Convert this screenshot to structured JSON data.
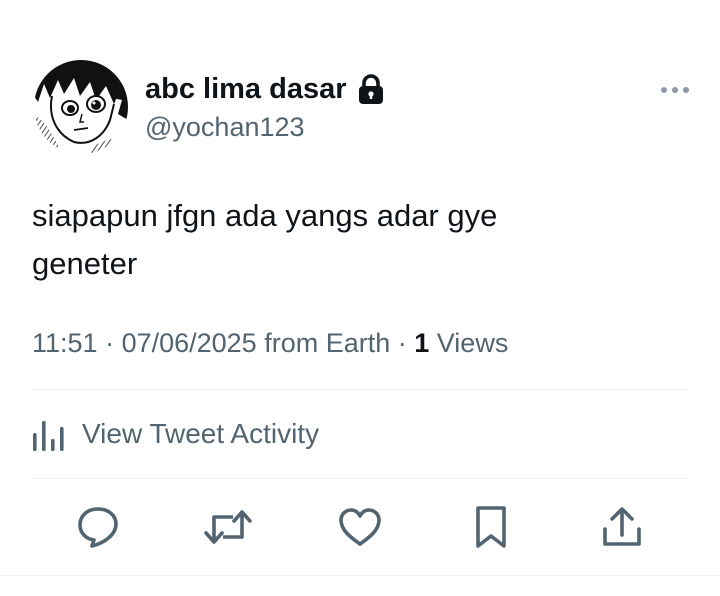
{
  "author": {
    "display_name": "abc lima dasar",
    "handle": "@yochan123",
    "protected": true,
    "avatar": "manga-style-character-avatar"
  },
  "tweet": {
    "text_line1": "siapapun jfgn ada yangs adar gye",
    "text_line2": "geneter"
  },
  "meta": {
    "time": "11:51",
    "sep1": " · ",
    "date": "07/06/2025",
    "from": " from Earth",
    "sep2": " · ",
    "views_count": "1",
    "views_label": " Views"
  },
  "activity": {
    "label": "View Tweet Activity",
    "icon": "analytics-bars-icon"
  },
  "actions": [
    {
      "name": "reply",
      "icon": "reply-icon"
    },
    {
      "name": "retweet",
      "icon": "retweet-icon"
    },
    {
      "name": "like",
      "icon": "heart-icon"
    },
    {
      "name": "bookmark",
      "icon": "bookmark-icon"
    },
    {
      "name": "share",
      "icon": "share-icon"
    }
  ],
  "colors": {
    "text_primary": "#0f1419",
    "text_secondary": "#536471",
    "divider": "#eff3f4",
    "more_dots": "#8b98a5"
  }
}
